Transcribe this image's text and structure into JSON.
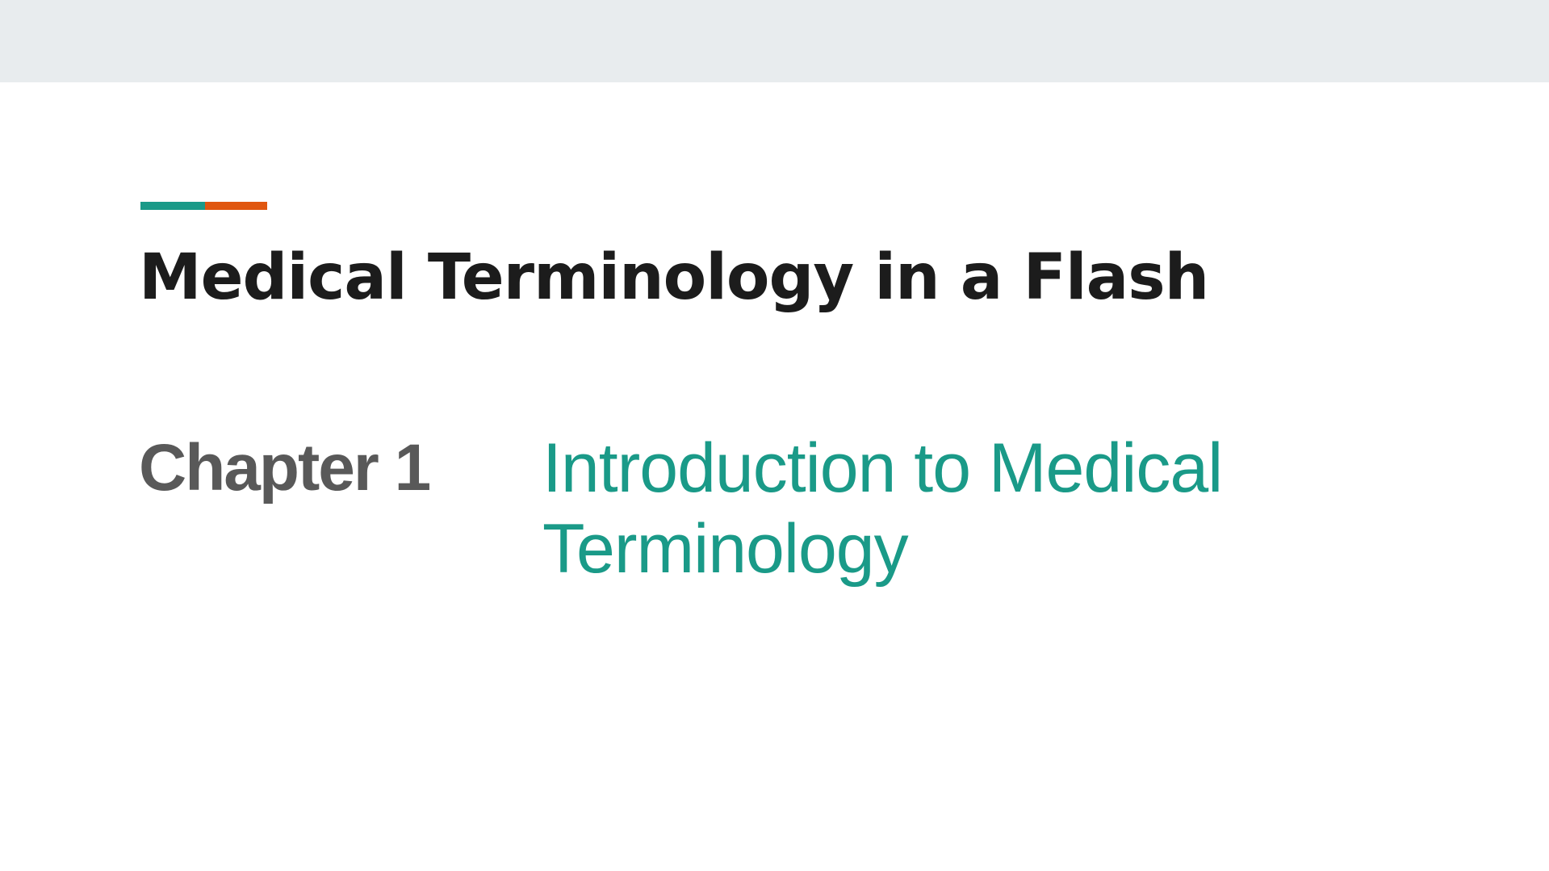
{
  "slide": {
    "title": "Medical Terminology in a Flash",
    "chapter_label": "Chapter 1",
    "chapter_subtitle": "Introduction to Medical Terminology"
  },
  "colors": {
    "accent_teal": "#1a9a88",
    "accent_orange": "#e0560f",
    "title_text": "#1c1c1c",
    "chapter_label_text": "#595959",
    "subtitle_text": "#1a9a88",
    "top_band": "#e8ecee"
  }
}
